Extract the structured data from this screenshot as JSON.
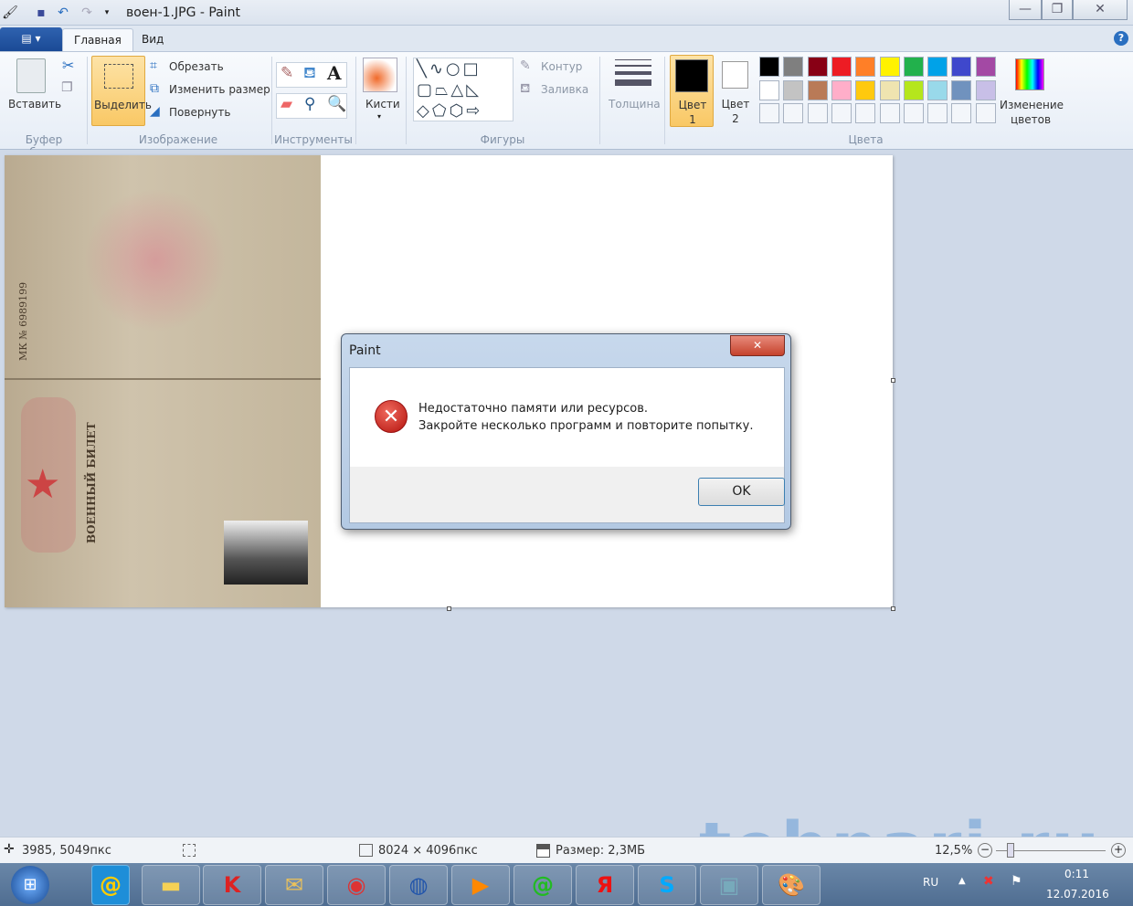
{
  "window": {
    "title": "воен-1.JPG - Paint",
    "minimize": "—",
    "maximize": "❐",
    "close": "✕"
  },
  "tabs": [
    {
      "label": "Главная"
    },
    {
      "label": "Вид"
    }
  ],
  "file_menu": "▤ ▾",
  "ribbon": {
    "clipboard": {
      "paste": "Вставить",
      "group": "Буфер обмена"
    },
    "image": {
      "select": "Выделить",
      "crop": "Обрезать",
      "resize": "Изменить размер",
      "rotate": "Повернуть",
      "group": "Изображение"
    },
    "tools": {
      "group": "Инструменты"
    },
    "brushes": {
      "label": "Кисти"
    },
    "shapes": {
      "outline": "Контур",
      "fill": "Заливка",
      "group": "Фигуры"
    },
    "size": {
      "label": "Толщина"
    },
    "colors": {
      "color1": "Цвет 1",
      "color2": "Цвет 2",
      "edit": "Изменение цветов",
      "group": "Цвета",
      "color1_value": "#000000",
      "color2_value": "#ffffff",
      "palette_row1": [
        "#000000",
        "#7f7f7f",
        "#880015",
        "#ed1c24",
        "#ff7f27",
        "#fff200",
        "#22b14c",
        "#00a2e8",
        "#3f48cc",
        "#a349a4"
      ],
      "palette_row2": [
        "#ffffff",
        "#c3c3c3",
        "#b97a57",
        "#ffaec9",
        "#ffc90e",
        "#efe4b0",
        "#b5e61d",
        "#99d9ea",
        "#7092be",
        "#c8bfe7"
      ]
    }
  },
  "document": {
    "title": "ВОЕННЫЙ БИЛЕТ",
    "number": "МК № 6989199"
  },
  "dialog": {
    "title": "Paint",
    "line1": "Недостаточно памяти или ресурсов.",
    "line2": "Закройте несколько программ и повторите попытку.",
    "ok": "OK",
    "close": "✕"
  },
  "status": {
    "cursor": "3985, 5049пкс",
    "dimensions": "8024 × 4096пкс",
    "size": "Размер: 2,3МБ",
    "zoom": "12,5%"
  },
  "taskbar": {
    "lang": "RU",
    "time": "0:11",
    "date": "12.07.2016"
  },
  "watermark": "tehnari.ru"
}
